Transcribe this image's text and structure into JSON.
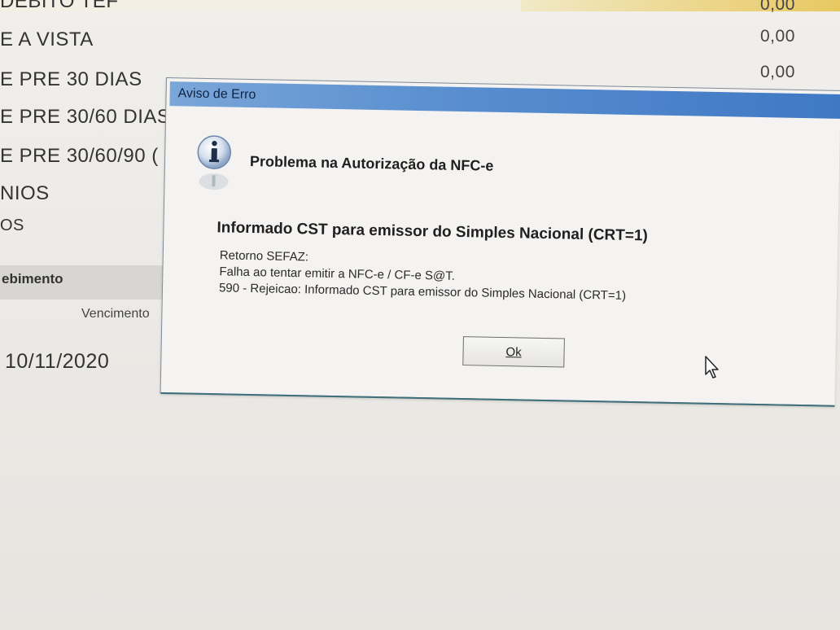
{
  "background_app": {
    "payment_rows": [
      {
        "label": "DEBITO TEF",
        "value": "0,00"
      },
      {
        "label": "E A VISTA",
        "value": "0,00"
      },
      {
        "label": "E PRE 30 DIAS",
        "value": "0,00"
      },
      {
        "label": "E PRE 30/60 DIAS",
        "value": ""
      },
      {
        "label": "E PRE 30/60/90 (",
        "value": ""
      },
      {
        "label": "NIOS",
        "value": ""
      },
      {
        "label": "OS",
        "value": ""
      }
    ],
    "section_label": "ebimento",
    "column_header": "Vencimento",
    "due_date": "10/11/2020"
  },
  "dialog": {
    "title": "Aviso de Erro",
    "icon": "info-icon",
    "headline": "Problema na Autorização da NFC-e",
    "subheadline": "Informado CST para emissor do Simples Nacional (CRT=1)",
    "details": [
      "Retorno SEFAZ:",
      "Falha ao tentar emitir a NFC-e / CF-e S@T.",
      "590 - Rejeicao: Informado CST para emissor do Simples Nacional (CRT=1)"
    ],
    "ok_label": "Ok"
  },
  "colors": {
    "titlebar_start": "#7aa6d8",
    "titlebar_end": "#3f78c4",
    "dialog_background": "#f4f3f1"
  }
}
